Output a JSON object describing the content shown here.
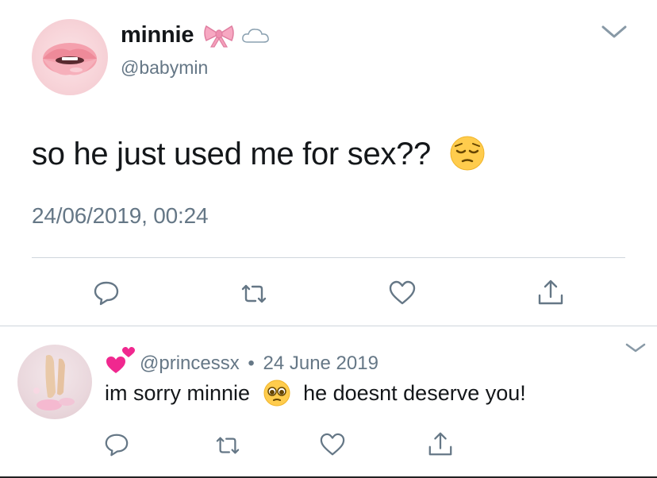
{
  "tweet": {
    "display_name": "minnie",
    "name_emojis": [
      "ribbon-emoji",
      "cloud-emoji"
    ],
    "handle": "@babymin",
    "text": "so he just used me for sex??",
    "text_emoji": "pensive-face-emoji",
    "timestamp": "24/06/2019, 00:24",
    "actions": [
      "reply-icon",
      "retweet-icon",
      "like-icon",
      "share-icon"
    ]
  },
  "reply": {
    "badge_emoji": "two-hearts-emoji",
    "handle": "@princessx",
    "separator": "•",
    "date": "24 June 2019",
    "text_before": "im sorry minnie",
    "text_emoji": "pleading-face-emoji",
    "text_after": "he doesnt deserve you!",
    "actions": [
      "reply-icon",
      "retweet-icon",
      "like-icon",
      "share-icon"
    ]
  },
  "colors": {
    "primary_text": "#14171a",
    "secondary_text": "#657786",
    "divider": "#cfd6dc"
  }
}
